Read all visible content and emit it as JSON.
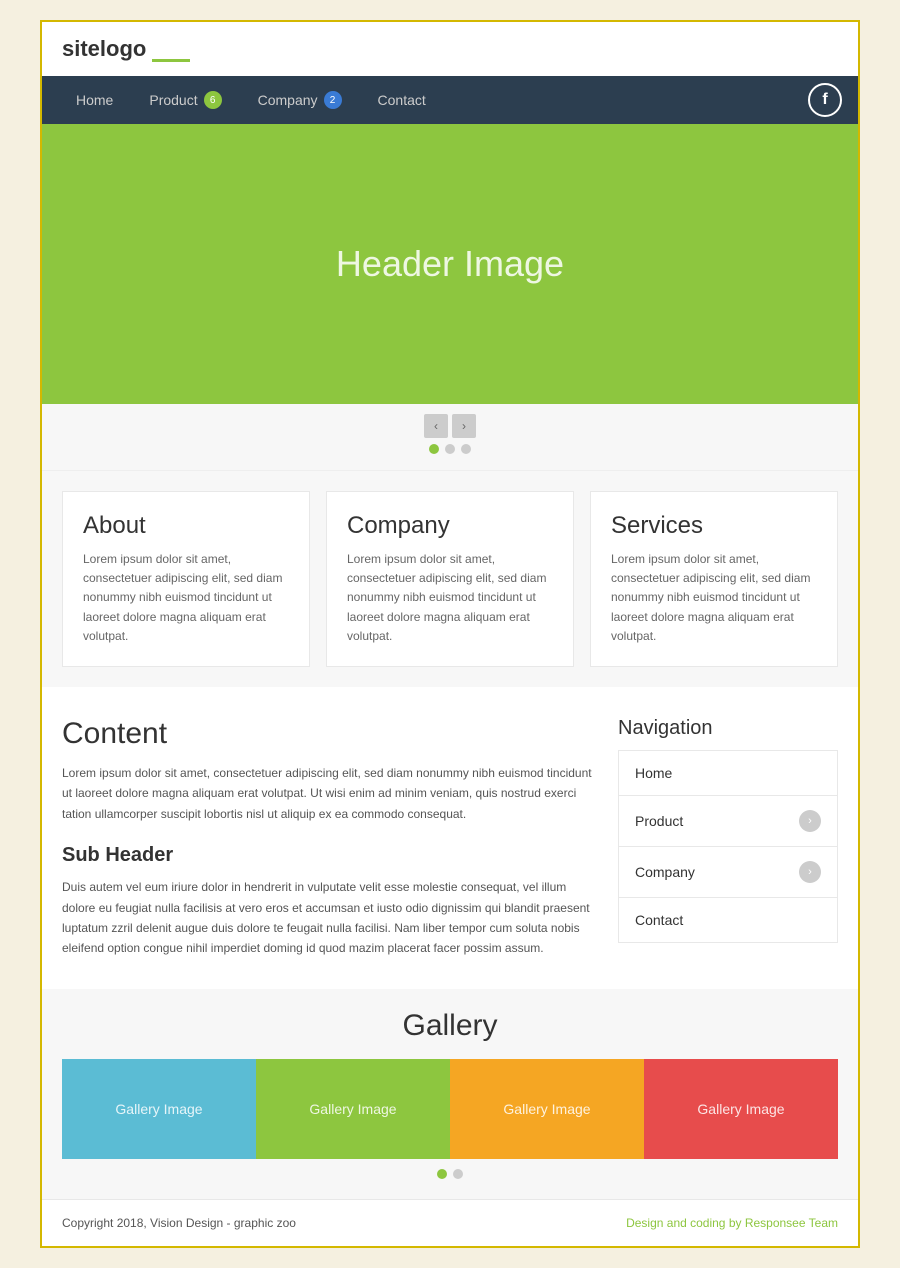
{
  "header": {
    "logo_site": "site",
    "logo_logo": "logo"
  },
  "nav": {
    "items": [
      {
        "label": "Home",
        "badge": null
      },
      {
        "label": "Product",
        "badge": "6",
        "badge_color": "green"
      },
      {
        "label": "Company",
        "badge": "2",
        "badge_color": "blue"
      },
      {
        "label": "Contact",
        "badge": null
      }
    ],
    "social_label": "f"
  },
  "hero": {
    "title": "Header Image"
  },
  "slider": {
    "prev_label": "‹",
    "next_label": "›",
    "dots": [
      true,
      false,
      false
    ]
  },
  "cards": [
    {
      "title": "About",
      "text": "Lorem ipsum dolor sit amet, consectetuer adipiscing elit, sed diam nonummy nibh euismod tincidunt ut laoreet dolore magna aliquam erat volutpat."
    },
    {
      "title": "Company",
      "text": "Lorem ipsum dolor sit amet, consectetuer adipiscing elit, sed diam nonummy nibh euismod tincidunt ut laoreet dolore magna aliquam erat volutpat."
    },
    {
      "title": "Services",
      "text": "Lorem ipsum dolor sit amet, consectetuer adipiscing elit, sed diam nonummy nibh euismod tincidunt ut laoreet dolore magna aliquam erat volutpat."
    }
  ],
  "content": {
    "title": "Content",
    "text": "Lorem ipsum dolor sit amet, consectetuer adipiscing elit, sed diam nonummy nibh euismod tincidunt ut laoreet dolore magna aliquam erat volutpat. Ut wisi enim ad minim veniam, quis nostrud exerci tation ullamcorper suscipit lobortis nisl ut aliquip ex ea commodo consequat.",
    "subheader": "Sub Header",
    "body": "Duis autem vel eum iriure dolor in hendrerit in vulputate velit esse molestie consequat, vel illum dolore eu feugiat nulla facilisis at vero eros et accumsan et iusto odio dignissim qui blandit praesent luptatum zzril delenit augue duis dolore te feugait nulla facilisi. Nam liber tempor cum soluta nobis eleifend option congue nihil imperdiet doming id quod mazim placerat facer possim assum."
  },
  "sidebar_nav": {
    "title": "Navigation",
    "items": [
      {
        "label": "Home",
        "has_arrow": false
      },
      {
        "label": "Product",
        "has_arrow": true
      },
      {
        "label": "Company",
        "has_arrow": true
      },
      {
        "label": "Contact",
        "has_arrow": false
      }
    ]
  },
  "gallery": {
    "title": "Gallery",
    "items": [
      {
        "label": "Gallery Image",
        "color": "#5bbcd4"
      },
      {
        "label": "Gallery Image",
        "color": "#8dc63f"
      },
      {
        "label": "Gallery Image",
        "color": "#f5a623"
      },
      {
        "label": "Gallery Image",
        "color": "#e74c4c"
      }
    ],
    "dots": [
      true,
      false
    ]
  },
  "footer": {
    "left": "Copyright 2018, Vision Design - graphic zoo",
    "right": "Design and coding by Responsee Team"
  }
}
